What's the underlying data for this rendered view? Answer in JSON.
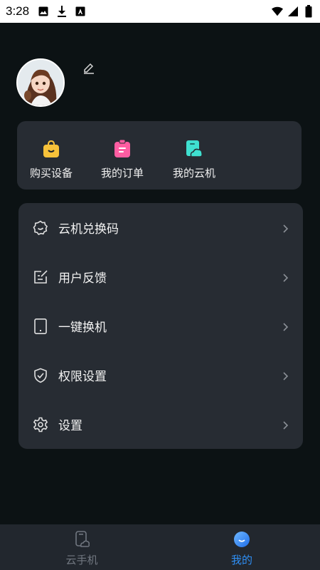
{
  "status_bar": {
    "time": "3:28",
    "icons": [
      "image-icon",
      "download-icon",
      "font-a-icon",
      "wifi-icon",
      "signal-icon",
      "battery-icon"
    ]
  },
  "profile": {
    "avatar": "avatar-girl",
    "edit_icon": "edit-icon"
  },
  "quick_actions": [
    {
      "label": "购买设备",
      "icon": "shopping-bag-icon",
      "color": "#f7c23a"
    },
    {
      "label": "我的订单",
      "icon": "clipboard-icon",
      "color": "#ff5da2"
    },
    {
      "label": "我的云机",
      "icon": "cloud-phone-icon",
      "color": "#3fe0d0"
    }
  ],
  "menu": [
    {
      "label": "云机兑换码",
      "icon": "badge-check-icon"
    },
    {
      "label": "用户反馈",
      "icon": "feedback-edit-icon"
    },
    {
      "label": "一键换机",
      "icon": "phone-icon"
    },
    {
      "label": "权限设置",
      "icon": "shield-check-icon"
    },
    {
      "label": "设置",
      "icon": "gear-icon"
    }
  ],
  "bottom_nav": [
    {
      "label": "云手机",
      "icon": "cloud-phone-nav-icon",
      "active": false
    },
    {
      "label": "我的",
      "icon": "me-face-icon",
      "active": true
    }
  ],
  "colors": {
    "background": "#0c1214",
    "card": "#272c33",
    "nav_bg": "#22272e",
    "active": "#2f8ff5",
    "inactive": "#717780"
  }
}
